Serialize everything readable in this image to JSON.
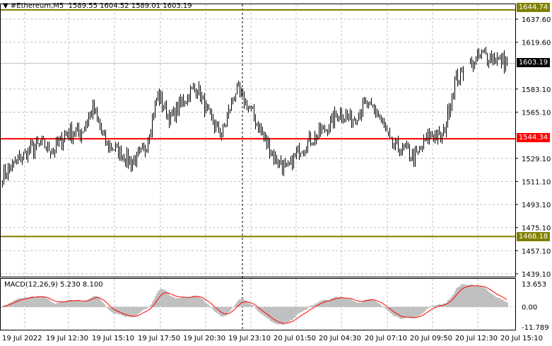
{
  "header": {
    "symbol": "#Ethereum,M5",
    "ohlc": "1589.55 1604.52 1589.01 1603.19"
  },
  "price_axis": [
    "1637.60",
    "1619.60",
    "1583.10",
    "1565.10",
    "1529.10",
    "1511.10",
    "1493.10",
    "1475.10",
    "1457.10",
    "1439.10"
  ],
  "levels": {
    "resistance": "1644.74",
    "current": "1603.19",
    "pivot": "1544.34",
    "support": "1468.18"
  },
  "colors": {
    "level": "#808000",
    "pivot": "#ff0000",
    "current": "#000000",
    "hist": "#c0c0c0",
    "signal": "#ff0000"
  },
  "macd": {
    "label": "MACD(12,26,9) 5.230 8.100",
    "max": "13.653",
    "zero": "0.00",
    "min": "-11.789"
  },
  "time_axis": [
    "19 Jul 2022",
    "19 Jul 12:30",
    "19 Jul 15:10",
    "19 Jul 17:50",
    "19 Jul 20:30",
    "19 Jul 23:10",
    "20 Jul 01:50",
    "20 Jul 04:30",
    "20 Jul 07:10",
    "20 Jul 09:50",
    "20 Jul 12:30",
    "20 Jul 15:10"
  ],
  "chart_data": {
    "type": "ohlc",
    "keypoints_price": [
      1515,
      1525,
      1535,
      1540,
      1535,
      1550,
      1548,
      1568,
      1540,
      1535,
      1525,
      1535,
      1578,
      1560,
      1575,
      1585,
      1560,
      1548,
      1582,
      1570,
      1550,
      1530,
      1520,
      1537,
      1545,
      1552,
      1565,
      1560,
      1570,
      1565,
      1540,
      1535,
      1530,
      1548,
      1545,
      1590,
      1600,
      1610,
      1608,
      1603
    ],
    "ylim": [
      1439.1,
      1644.74
    ]
  }
}
